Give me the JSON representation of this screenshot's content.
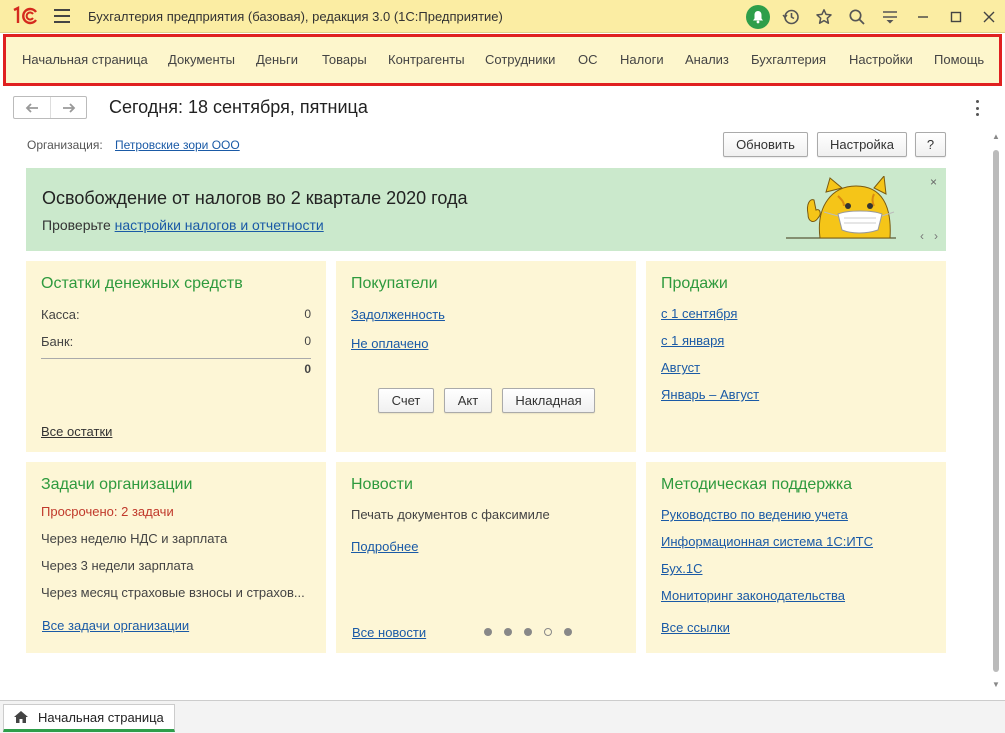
{
  "titlebar": {
    "title": "Бухгалтерия предприятия (базовая), редакция 3.0  (1С:Предприятие)",
    "accent": "#2e9e4a"
  },
  "menu": [
    {
      "label": "Начальная страница"
    },
    {
      "label": "Документы"
    },
    {
      "label": "Деньги"
    },
    {
      "label": "Товары"
    },
    {
      "label": "Контрагенты"
    },
    {
      "label": "Сотрудники"
    },
    {
      "label": "ОС"
    },
    {
      "label": "Налоги"
    },
    {
      "label": "Анализ"
    },
    {
      "label": "Бухгалтерия"
    },
    {
      "label": "Настройки"
    },
    {
      "label": "Помощь"
    }
  ],
  "header": {
    "title": "Сегодня: 18 сентября, пятница",
    "org_label": "Организация:",
    "org_value": "Петровские зори ООО",
    "refresh_label": "Обновить",
    "settings_label": "Настройка",
    "help_label": "?"
  },
  "banner": {
    "title": "Освобождение от налогов во 2 квартале 2020 года",
    "text_prefix": "Проверьте ",
    "link": "настройки налогов и отчетности",
    "close": "×",
    "prev": "‹",
    "next": "›"
  },
  "cash": {
    "title": "Остатки денежных средств",
    "rows": [
      {
        "label": "Касса:",
        "value": "0"
      },
      {
        "label": "Банк:",
        "value": "0"
      }
    ],
    "total": "0",
    "all_link": "Все остатки"
  },
  "buyers": {
    "title": "Покупатели",
    "links": [
      "Задолженность",
      "Не оплачено"
    ],
    "buttons": [
      "Счет",
      "Акт",
      "Накладная"
    ]
  },
  "sales": {
    "title": "Продажи",
    "links": [
      "с 1 сентября",
      "с 1 января",
      "Август",
      "Январь – Август"
    ]
  },
  "tasks": {
    "title": "Задачи организации",
    "overdue": "Просрочено: 2 задачи",
    "items": [
      "Через неделю НДС и зарплата",
      "Через 3 недели зарплата",
      "Через месяц страховые взносы и страхов..."
    ],
    "all_link": "Все задачи организации"
  },
  "news": {
    "title": "Новости",
    "text": "Печать документов с факсимиле",
    "more_link": "Подробнее",
    "all_link": "Все новости",
    "dots_total": 5,
    "active_dot": 4
  },
  "support": {
    "title": "Методическая поддержка",
    "links": [
      "Руководство по ведению учета",
      "Информационная система 1С:ИТС",
      "Бух.1С",
      "Мониторинг законодательства"
    ],
    "all_link": "Все ссылки"
  },
  "bottom_tab": {
    "label": "Начальная страница"
  }
}
